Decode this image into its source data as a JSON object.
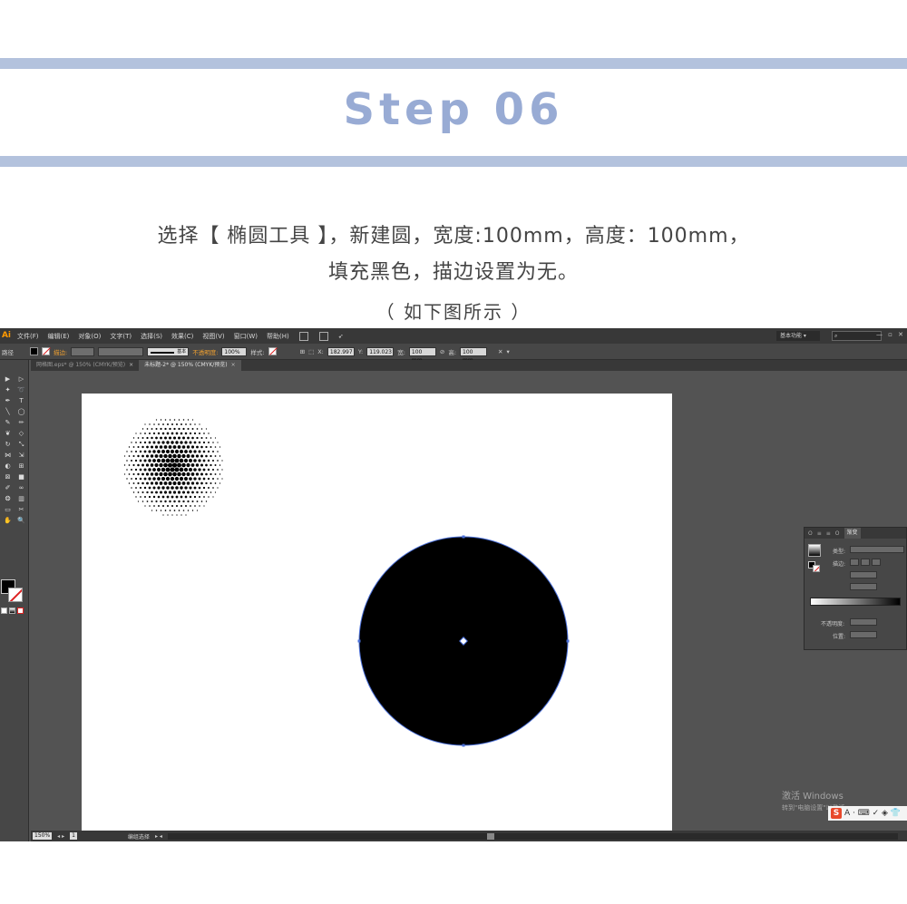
{
  "tutorial": {
    "step_title": "Step 06",
    "line1": "选择【 椭圆工具 】，新建圆，宽度:100mm，高度：100mm，",
    "line2": "填充黑色，描边设置为无。",
    "caption": "（ 如下图所示 ）",
    "band_color": "#b3c2dd",
    "title_color": "#98abd4"
  },
  "app": {
    "logo": "Ai",
    "menus": [
      "文件(F)",
      "编辑(E)",
      "对象(O)",
      "文字(T)",
      "选择(S)",
      "效果(C)",
      "视图(V)",
      "窗口(W)",
      "帮助(H)"
    ],
    "workspace_label": "基本功能 ▾",
    "search_placeholder": "",
    "window_controls": "— ▫ ✕"
  },
  "control_bar": {
    "object_label": "路径",
    "stroke_label": "描边:",
    "stroke_style": "基本",
    "opacity_label": "不透明度:",
    "opacity_value": "100%",
    "style_label": "样式:",
    "x_label": "X:",
    "x_value": "182.997",
    "y_label": "Y:",
    "y_value": "119.023",
    "w_label": "宽:",
    "w_value": "100 mm",
    "h_label": "高:",
    "h_value": "100 mm"
  },
  "tabs": [
    {
      "label": "网格图.eps* @ 150% (CMYK/预览)",
      "active": false
    },
    {
      "label": "未标题-2* @ 150% (CMYK/预览)",
      "active": true
    }
  ],
  "tool_icons": [
    "selection-icon",
    "direct-selection-icon",
    "magic-wand-icon",
    "lasso-icon",
    "pen-icon",
    "type-icon",
    "line-icon",
    "ellipse-icon",
    "paintbrush-icon",
    "pencil-icon",
    "blob-brush-icon",
    "eraser-icon",
    "rotate-icon",
    "scale-icon",
    "width-icon",
    "free-transform-icon",
    "shape-builder-icon",
    "perspective-icon",
    "mesh-icon",
    "gradient-icon",
    "eyedropper-icon",
    "blend-icon",
    "symbol-sprayer-icon",
    "graph-icon",
    "artboard-icon",
    "slice-icon",
    "hand-icon",
    "zoom-icon"
  ],
  "tool_glyphs": [
    "▶",
    "▷",
    "✦",
    "➰",
    "✒",
    "T",
    "╲",
    "◯",
    "✎",
    "✏",
    "❦",
    "◇",
    "↻",
    "⤡",
    "⋈",
    "⇲",
    "◐",
    "⊞",
    "⊠",
    "■",
    "✐",
    "∞",
    "❂",
    "▥",
    "▭",
    "✂",
    "✋",
    "🔍"
  ],
  "gradient_panel": {
    "tabs": [
      "Ο",
      "≡",
      "≡",
      "Ο",
      "渐变"
    ],
    "type_label": "类型:",
    "stroke_label": "描边:",
    "opacity_label": "不透明度:",
    "location_label": "位置:"
  },
  "artwork": {
    "circle_fill": "#000000",
    "selection_color": "#4a6fd8",
    "halftone": "black dot-grid circle"
  },
  "watermark": {
    "line1": "激活 Windows",
    "line2": "转到\"电脑设置\"以激活"
  },
  "ime": {
    "s": "S",
    "items": "A · ⌨ ✓ ◈ 👕"
  },
  "status_bar": {
    "zoom": "150%",
    "page": "1",
    "tool_name": "编组选择"
  }
}
